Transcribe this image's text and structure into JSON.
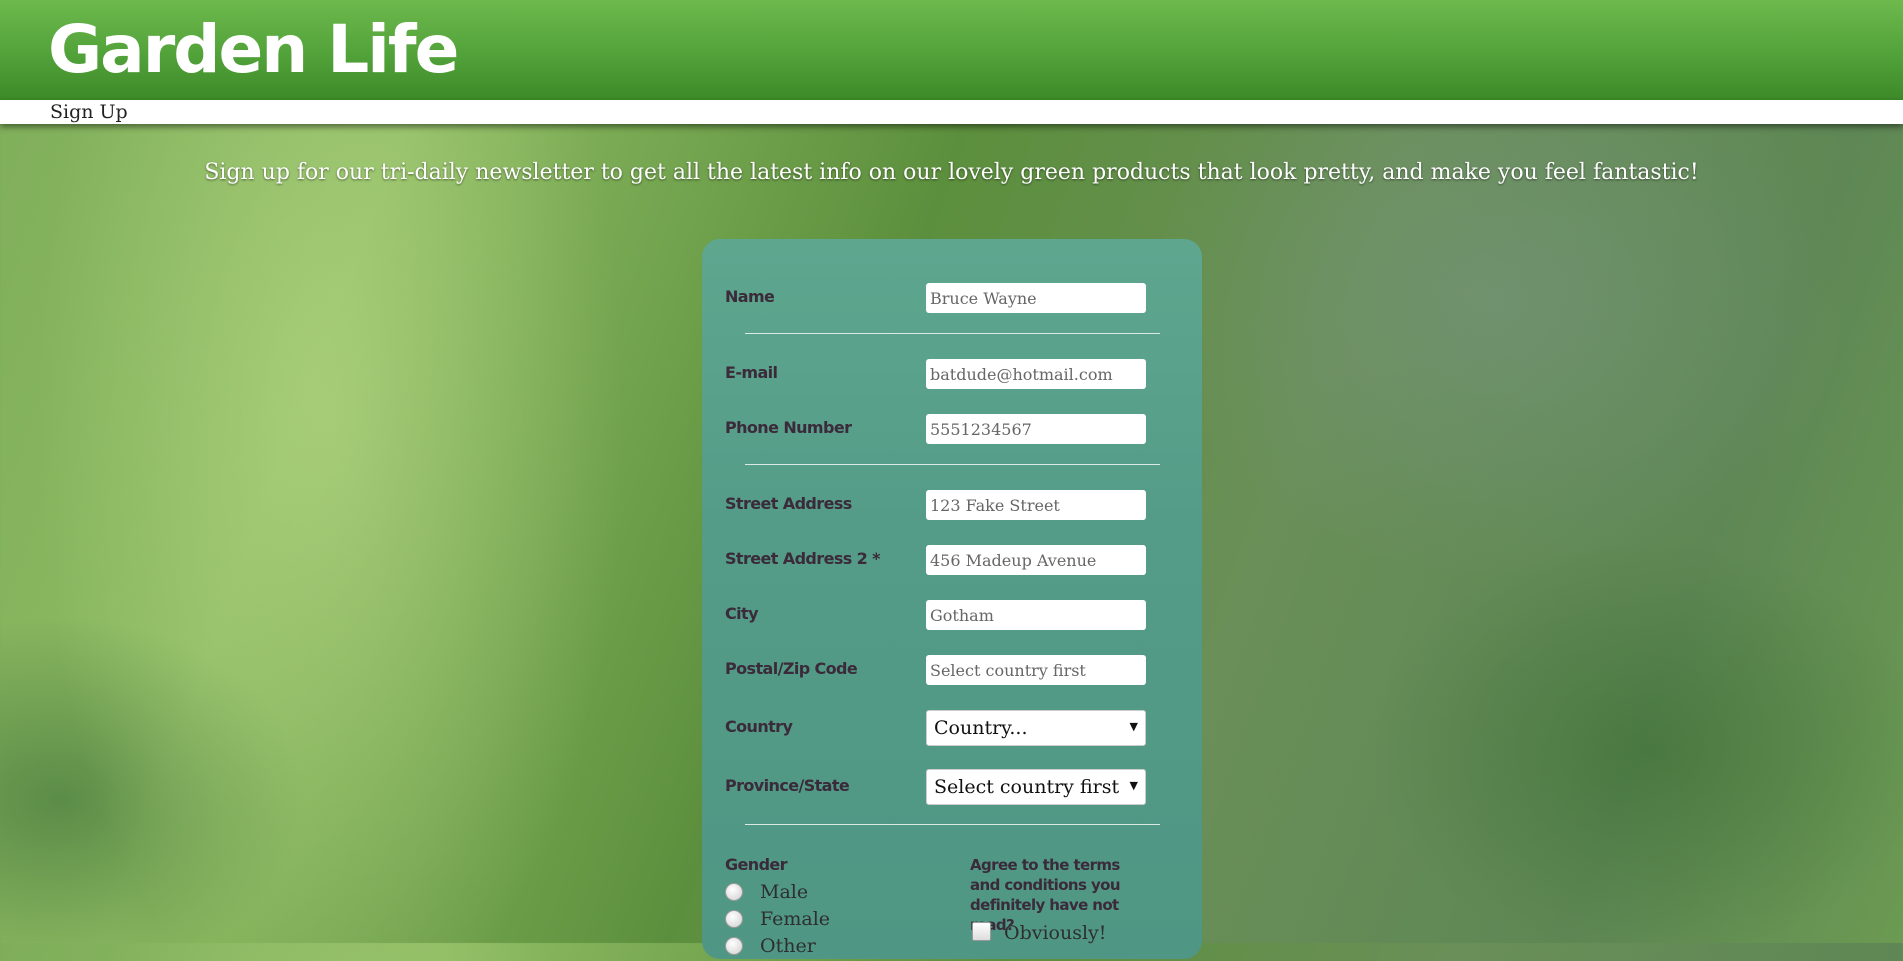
{
  "header": {
    "logo": "Garden Life"
  },
  "nav": {
    "items": [
      {
        "label": "Sign Up"
      }
    ]
  },
  "tagline": "Sign up for our tri-daily newsletter to get all the latest info on our lovely green products that look pretty, and make you feel fantastic!",
  "form": {
    "fields": [
      {
        "label": "Name",
        "value": "Bruce Wayne"
      },
      {
        "label": "E-mail",
        "value": "batdude@hotmail.com"
      },
      {
        "label": "Phone Number",
        "value": "5551234567"
      },
      {
        "label": "Street Address",
        "value": "123 Fake Street"
      },
      {
        "label": "Street Address 2 *",
        "value": "456 Madeup Avenue"
      },
      {
        "label": "City",
        "value": "Gotham"
      },
      {
        "label": "Postal/Zip Code",
        "value": "Select country first"
      }
    ],
    "country": {
      "label": "Country",
      "value": "Country..."
    },
    "province": {
      "label": "Province/State",
      "value": "Select country first"
    },
    "gender": {
      "label": "Gender",
      "options": [
        "Male",
        "Female",
        "Other"
      ]
    },
    "terms": {
      "label": "Agree to the terms and conditions you definitely have not read?",
      "checkbox_label": "Obviously!"
    }
  },
  "colors": {
    "header_green": "#52a23a",
    "card_teal": "#549c87",
    "label_text": "#3a2a3a"
  }
}
